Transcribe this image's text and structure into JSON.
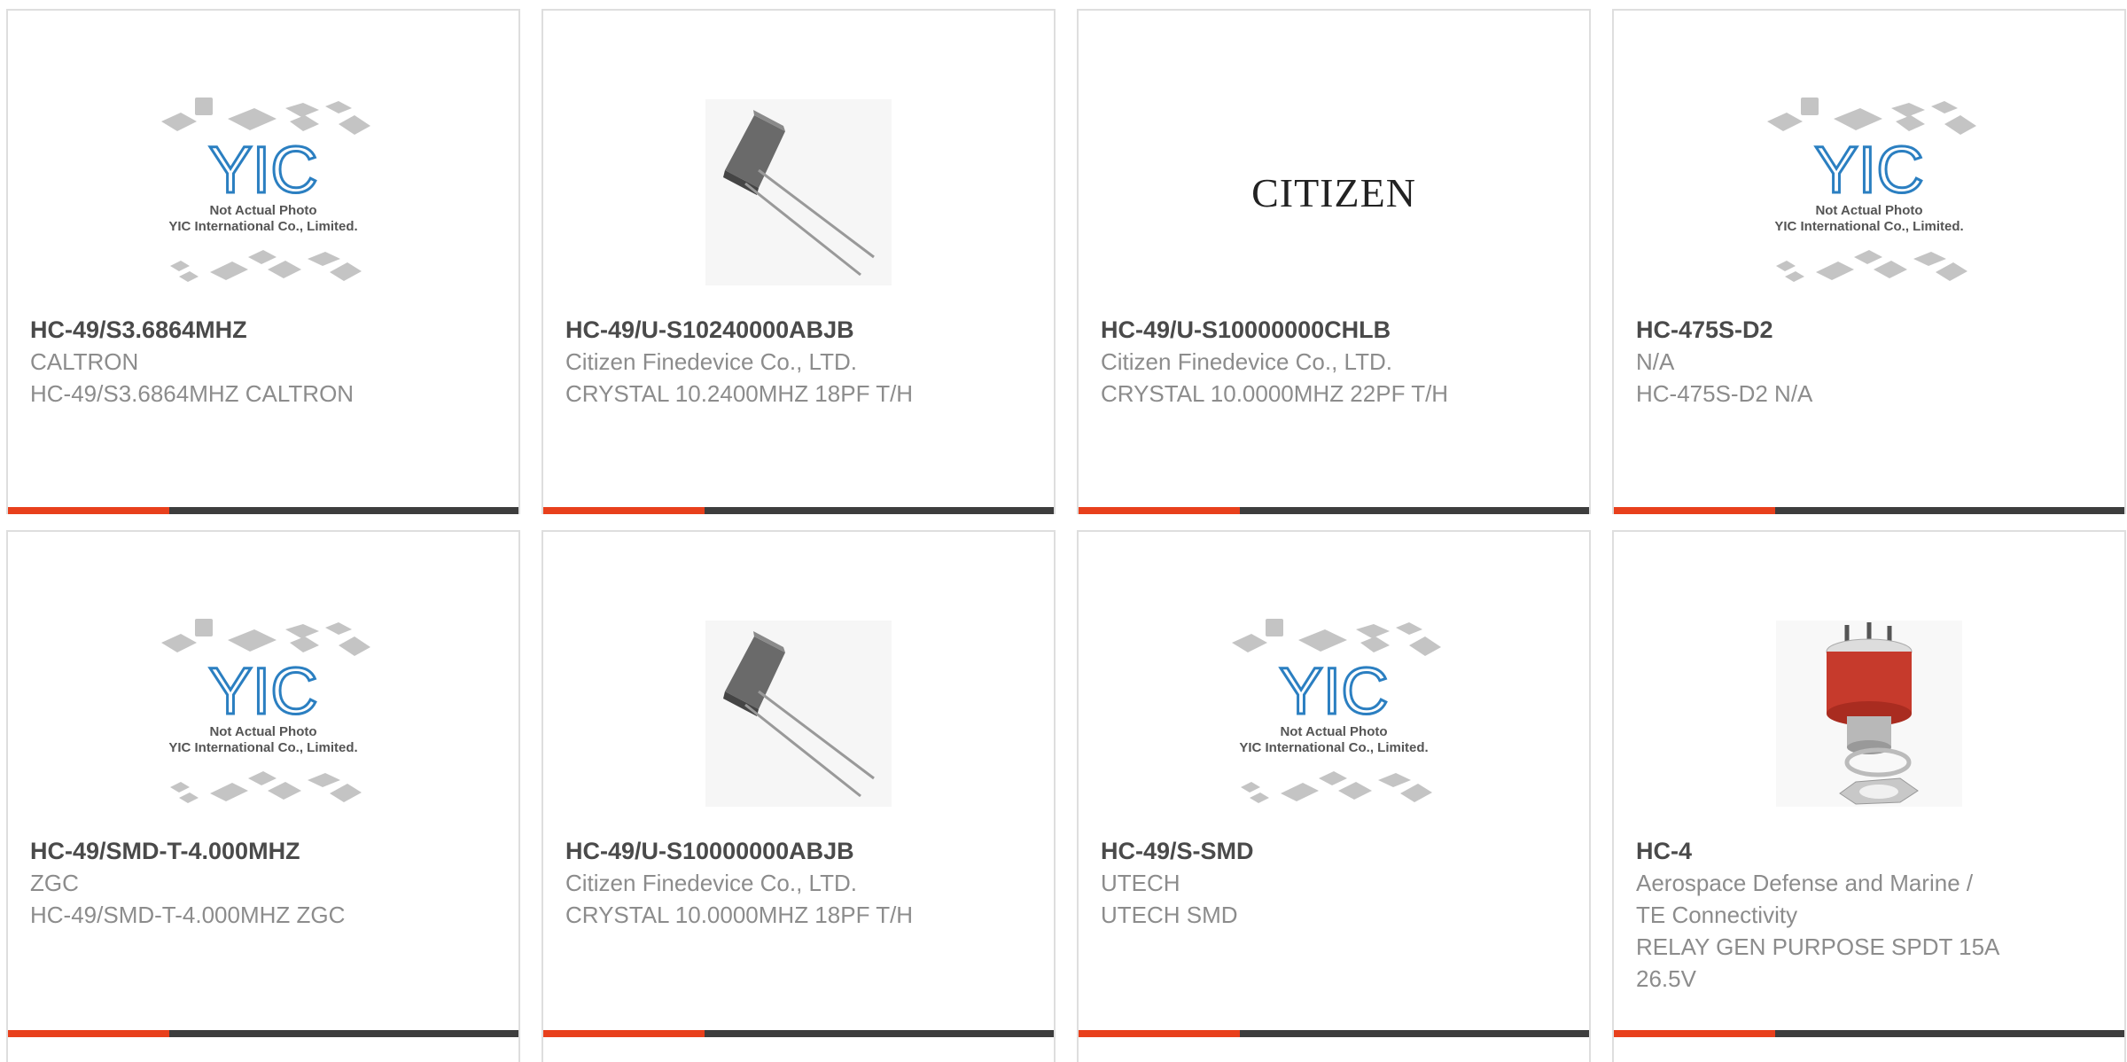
{
  "placeholder_image": {
    "logo_text": "YIC",
    "caption_line1": "Not Actual Photo",
    "caption_line2": "YIC International Co., Limited."
  },
  "citizen_logo_text": "CITIZEN",
  "colors": {
    "accent": "#e8401c",
    "bar": "#3d3d3d",
    "brand_blue": "#2b7fc1",
    "title": "#4a4a4a",
    "subtext": "#8c8c8c"
  },
  "products": [
    {
      "part_number": "HC-49/S3.6864MHZ",
      "manufacturer": "CALTRON",
      "description": "HC-49/S3.6864MHZ CALTRON",
      "image": "yic-placeholder"
    },
    {
      "part_number": "HC-49/U-S10240000ABJB",
      "manufacturer": "Citizen Finedevice Co., LTD.",
      "description": "CRYSTAL 10.2400MHZ 18PF T/H",
      "image": "crystal-photo"
    },
    {
      "part_number": "HC-49/U-S10000000CHLB",
      "manufacturer": "Citizen Finedevice Co., LTD.",
      "description": "CRYSTAL 10.0000MHZ 22PF T/H",
      "image": "citizen-logo"
    },
    {
      "part_number": "HC-475S-D2",
      "manufacturer": "N/A",
      "description": "HC-475S-D2 N/A",
      "image": "yic-placeholder"
    },
    {
      "part_number": "HC-49/SMD-T-4.000MHZ",
      "manufacturer": "ZGC",
      "description": "HC-49/SMD-T-4.000MHZ ZGC",
      "image": "yic-placeholder"
    },
    {
      "part_number": "HC-49/U-S10000000ABJB",
      "manufacturer": "Citizen Finedevice Co., LTD.",
      "description": "CRYSTAL 10.0000MHZ 18PF T/H",
      "image": "crystal-photo"
    },
    {
      "part_number": "HC-49/S-SMD",
      "manufacturer": "UTECH",
      "description": "UTECH SMD",
      "image": "yic-placeholder"
    },
    {
      "part_number": "HC-4",
      "manufacturer": "Aerospace Defense and Marine / TE Connectivity",
      "description": "RELAY GEN PURPOSE SPDT 15A 26.5V",
      "image": "relay-photo"
    }
  ]
}
